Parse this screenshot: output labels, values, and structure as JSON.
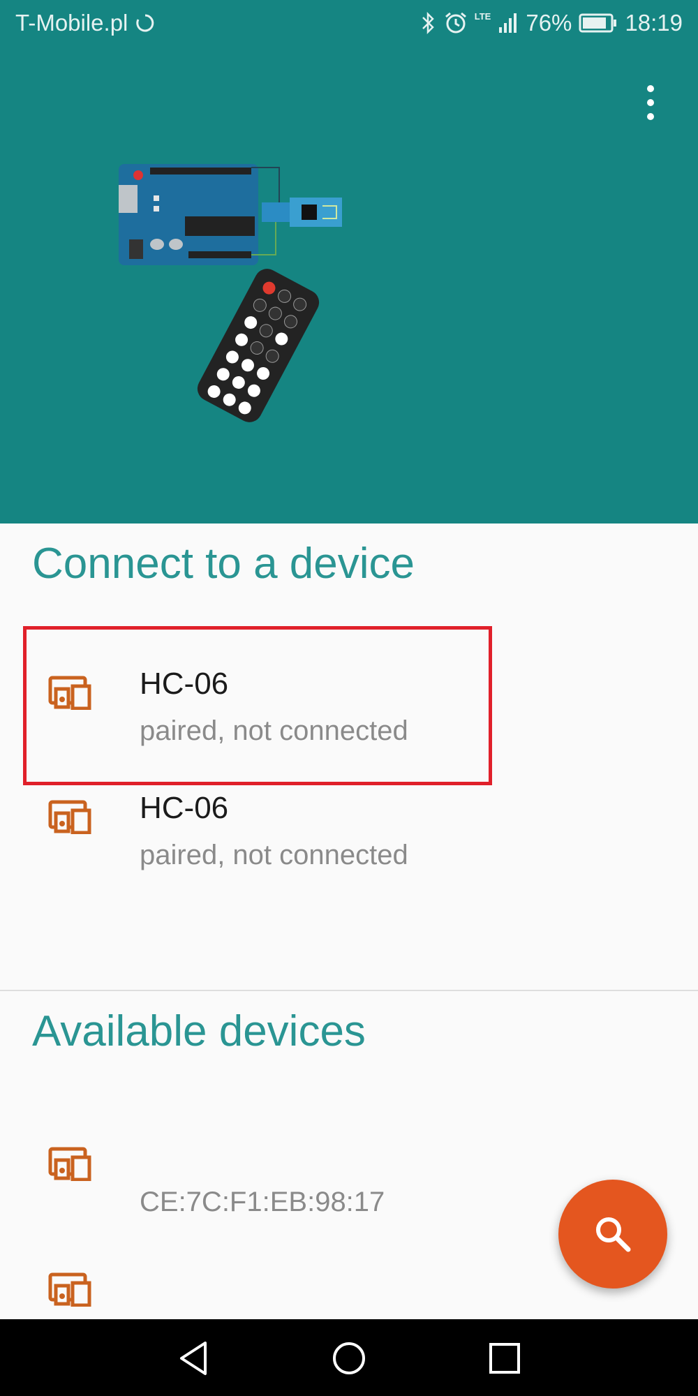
{
  "status_bar": {
    "carrier": "T-Mobile.pl",
    "network_label": "LTE",
    "battery": "76%",
    "time": "18:19",
    "icons": [
      "sync-icon",
      "bluetooth-icon",
      "alarm-icon",
      "signal-icon",
      "battery-icon"
    ]
  },
  "app_bar": {
    "menu_icon": "overflow-menu-icon"
  },
  "hero": {
    "image": "arduino-bluetooth-remote-illustration"
  },
  "paired": {
    "title": "Connect to a device",
    "devices": [
      {
        "name": "HC-06",
        "status": "paired, not connected"
      },
      {
        "name": "HC-06",
        "status": "paired, not connected"
      }
    ]
  },
  "available": {
    "title": "Available devices",
    "devices": [
      {
        "name": "",
        "address": "CE:7C:F1:EB:98:17"
      },
      {
        "name": "",
        "address": ""
      }
    ]
  },
  "fab": {
    "icon": "search-icon"
  },
  "colors": {
    "header": "#158582",
    "accent": "#2a9593",
    "device_icon": "#c9621f",
    "fab": "#e4561f",
    "highlight": "#e0202a"
  }
}
